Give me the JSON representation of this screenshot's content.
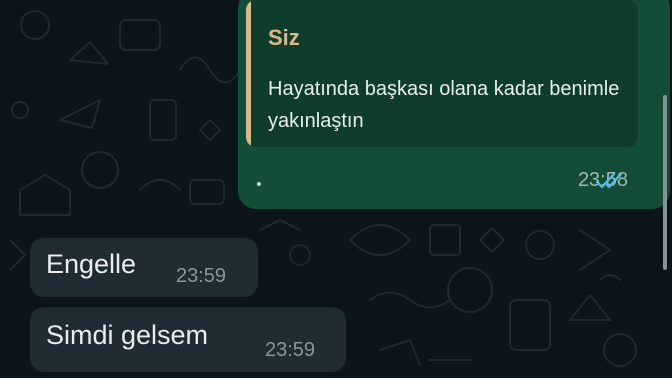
{
  "outgoing": {
    "quote_author": "Siz",
    "quote_text": "Hayatında başkası olana kadar benimle yakınlaştın",
    "time": "23:58",
    "status_icon": "double-check-read-icon"
  },
  "incoming": [
    {
      "text": "Engelle",
      "time": "23:59"
    },
    {
      "text": "Simdi gelsem",
      "time": "23:59"
    }
  ],
  "colors": {
    "background": "#0b141a",
    "outgoing_bubble": "#144d37",
    "quote_box": "#0f3d2c",
    "quote_accent": "#d9b98a",
    "incoming_bubble": "#202c33",
    "read_ticks": "#53bdeb",
    "text": "#e9edef"
  }
}
